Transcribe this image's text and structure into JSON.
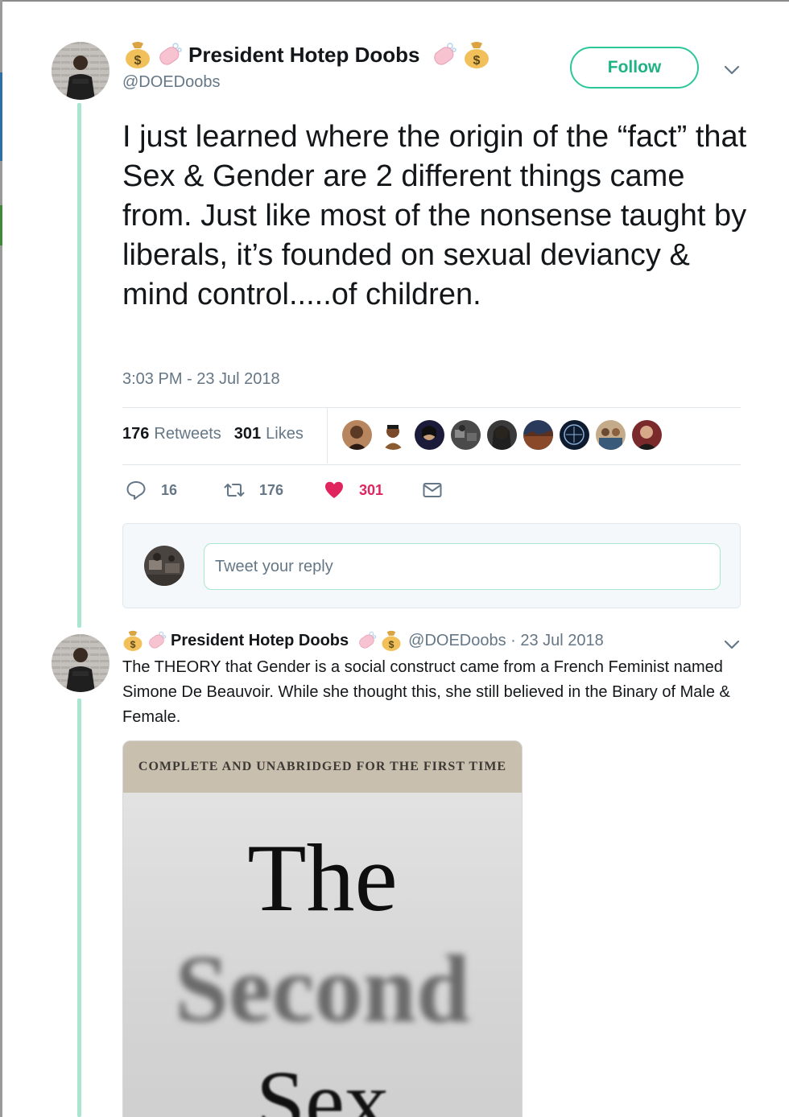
{
  "tweet": {
    "author": {
      "display_name": "President Hotep Doobs",
      "handle": "@DOEDoobs",
      "name_decor_icons": [
        "money-bag-icon",
        "soap-icon"
      ]
    },
    "follow_label": "Follow",
    "text": "I just learned where the origin of the “fact” that Sex & Gender are 2 different things came from. Just like most of the nonsense taught by liberals, it’s founded on sexual deviancy & mind control.....of children.",
    "timestamp": "3:03 PM - 23 Jul 2018",
    "retweets_count": "176",
    "retweets_label": "Retweets",
    "likes_count": "301",
    "likes_label": "Likes",
    "liker_avatar_count": 9,
    "actions": {
      "reply_count": "16",
      "retweet_count": "176",
      "like_count": "301",
      "like_active": true
    },
    "reply_placeholder": "Tweet your reply"
  },
  "reply_tweet": {
    "display_name": "President Hotep Doobs",
    "handle_date": "@DOEDoobs · 23 Jul 2018",
    "text": "The THEORY that Gender is a social construct came from a French Feminist named Simone De Beauvoir. While she thought this, she still believed in the Binary of Male & Female.",
    "image": {
      "band_text": "COMPLETE AND UNABRIDGED FOR THE FIRST TIME",
      "title_line1": "The",
      "title_line2": "Second",
      "title_line3": "Sex"
    }
  },
  "colors": {
    "follow_accent": "#2bc799",
    "thread_line": "#a8e6d0",
    "like_active": "#e0245e",
    "secondary_text": "#657786"
  }
}
